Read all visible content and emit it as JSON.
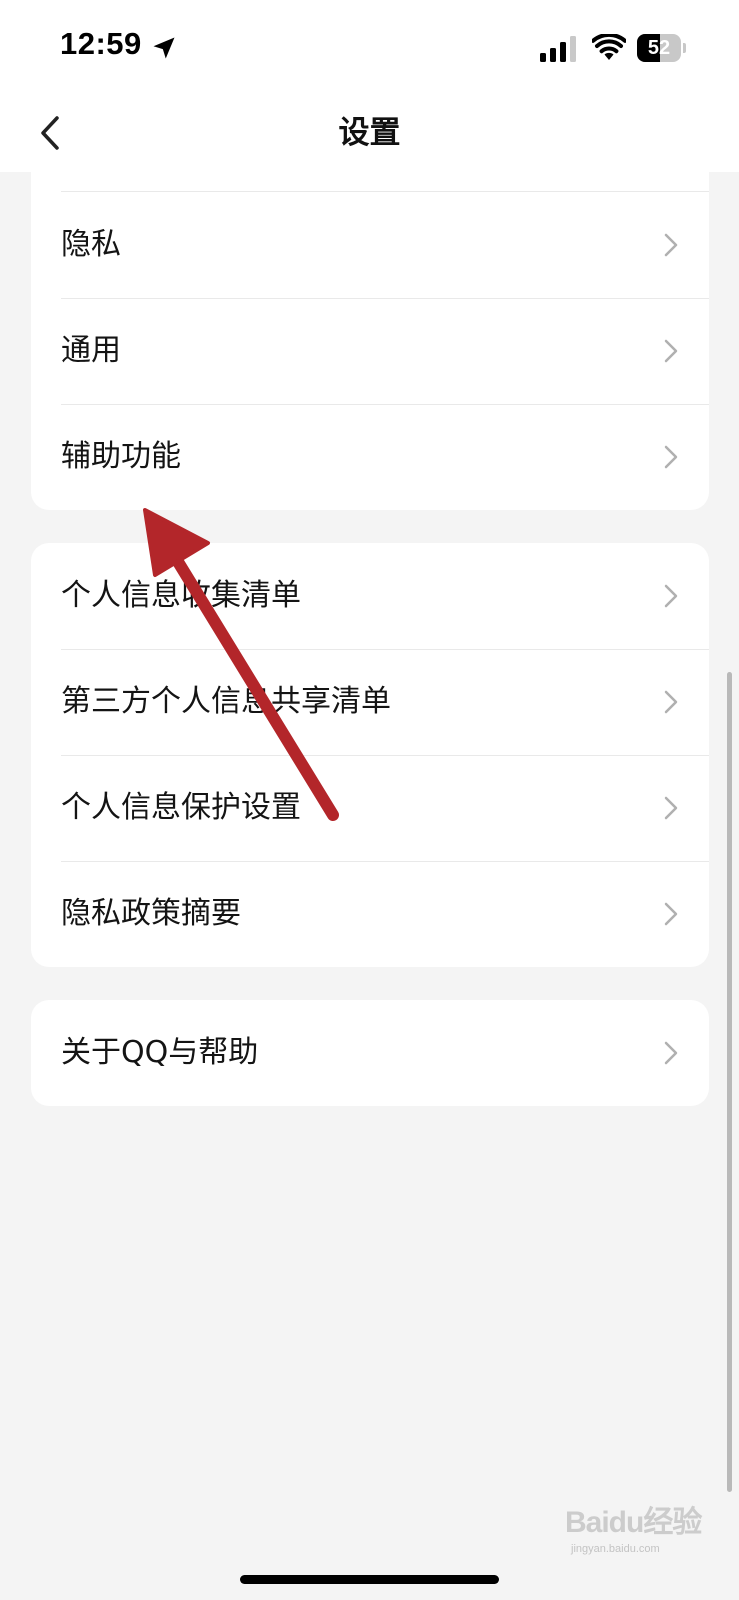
{
  "status_bar": {
    "time": "12:59",
    "battery_level": "52",
    "battery_fraction": 0.52,
    "icons": [
      "location-arrow-icon",
      "cellular-signal-icon",
      "wifi-icon",
      "battery-icon"
    ]
  },
  "nav": {
    "title": "设置",
    "back_icon": "chevron-left-icon"
  },
  "sections": [
    {
      "items": [
        {
          "label": "隐私",
          "icon": "chevron-right-icon"
        },
        {
          "label": "通用",
          "icon": "chevron-right-icon"
        },
        {
          "label": "辅助功能",
          "icon": "chevron-right-icon"
        }
      ]
    },
    {
      "items": [
        {
          "label": "个人信息收集清单",
          "icon": "chevron-right-icon"
        },
        {
          "label": "第三方个人信息共享清单",
          "icon": "chevron-right-icon"
        },
        {
          "label": "个人信息保护设置",
          "icon": "chevron-right-icon"
        },
        {
          "label": "隐私政策摘要",
          "icon": "chevron-right-icon"
        }
      ]
    },
    {
      "items": [
        {
          "label": "关于QQ与帮助",
          "icon": "chevron-right-icon"
        }
      ]
    }
  ],
  "watermark": {
    "brand": "Baidu经验",
    "url": "jingyan.baidu.com"
  },
  "colors": {
    "background": "#f4f4f4",
    "card": "#ffffff",
    "annotation_arrow": "#b3262a",
    "chevron": "#b0b0b0"
  }
}
